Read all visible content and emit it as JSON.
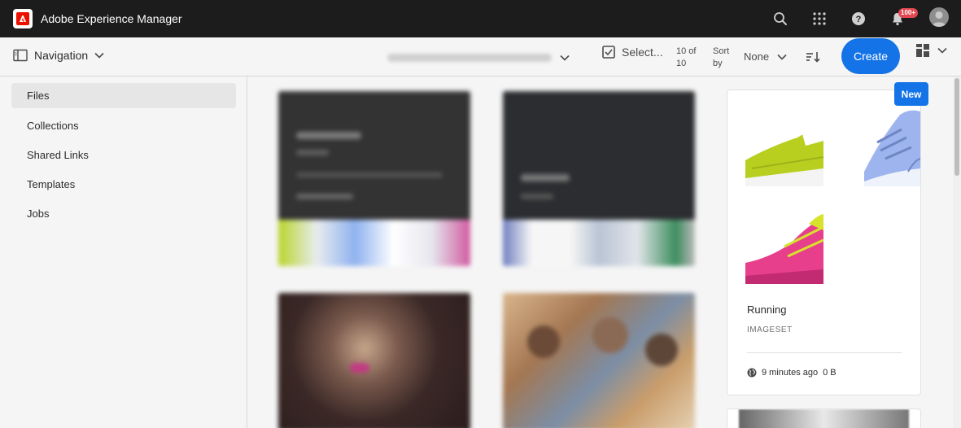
{
  "shell": {
    "app_title": "Adobe Experience Manager",
    "notification_count": "100+"
  },
  "actionbar": {
    "navigation_label": "Navigation",
    "select_label": "Select...",
    "count_line1": "10 of",
    "count_line2": "10",
    "sort_line1": "Sort",
    "sort_line2": "by",
    "sort_value": "None",
    "create_label": "Create"
  },
  "rail": {
    "items": [
      {
        "label": "Files"
      },
      {
        "label": "Collections"
      },
      {
        "label": "Shared Links"
      },
      {
        "label": "Templates"
      },
      {
        "label": "Jobs"
      }
    ]
  },
  "card": {
    "badge": "New",
    "title": "Running",
    "type": "IMAGESET",
    "time": "9 minutes ago",
    "size": "0 B"
  },
  "colors": {
    "shell_bg": "#1c1c1c",
    "accent": "#1473e6",
    "badge_red": "#e34850",
    "adobe_red": "#eb1000"
  }
}
